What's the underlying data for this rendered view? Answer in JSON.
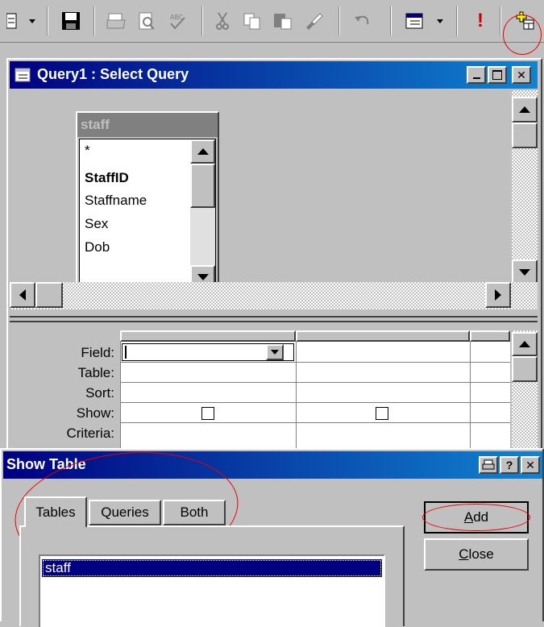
{
  "toolbar": {
    "icons": [
      "view-icon",
      "save-icon",
      "print-icon",
      "print-preview-icon",
      "spelling-icon",
      "cut-icon",
      "copy-icon",
      "paste-icon",
      "format-painter-icon",
      "undo-icon",
      "query-type-icon",
      "run-icon",
      "show-table-icon"
    ],
    "run_glyph": "!"
  },
  "query_window": {
    "title": "Query1 : Select Query",
    "table": {
      "name": "staff",
      "fields": [
        "*",
        "StaffID",
        "Staffname",
        "Sex",
        "Dob"
      ],
      "primary_key": "StaffID"
    },
    "grid": {
      "row_labels": [
        "Field:",
        "Table:",
        "Sort:",
        "Show:",
        "Criteria:"
      ],
      "show_checked": [
        false,
        false
      ]
    }
  },
  "show_table": {
    "title": "Show Table",
    "tabs": [
      "Tables",
      "Queries",
      "Both"
    ],
    "active_tab": "Tables",
    "list_items": [
      "staff"
    ],
    "selected_item": "staff",
    "buttons": {
      "add": {
        "accel": "A",
        "rest": "dd"
      },
      "close": {
        "accel": "C",
        "rest": "lose"
      }
    }
  },
  "colors": {
    "title_active": "#000080",
    "face": "#c0c0c0",
    "annotation_ring": "#e00000",
    "selection": "#000080"
  }
}
